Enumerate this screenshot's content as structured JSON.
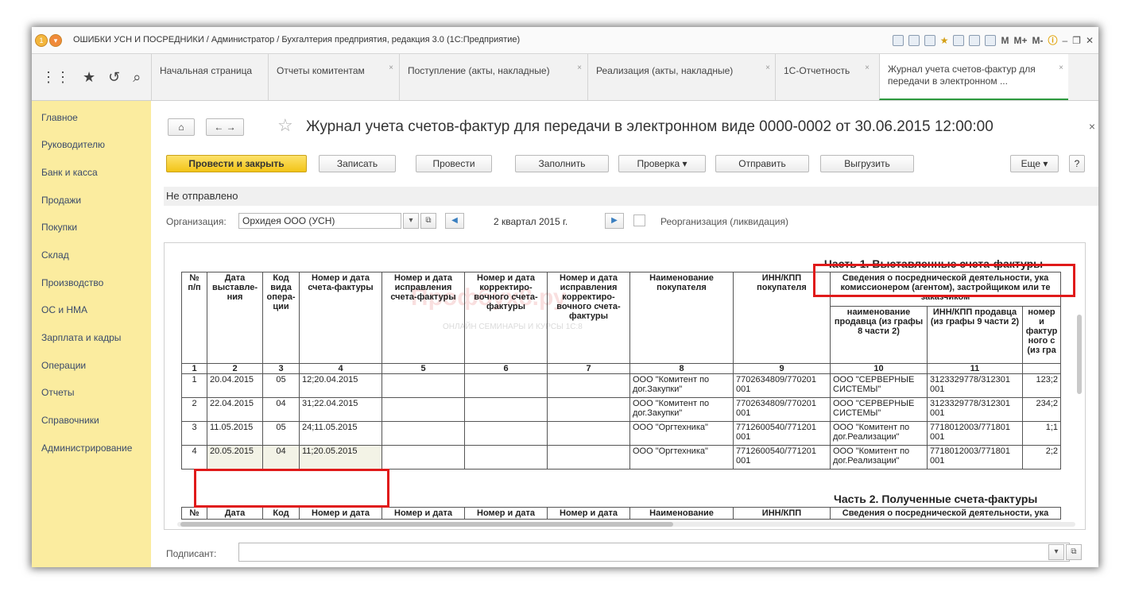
{
  "window": {
    "title": "ОШИБКИ УСН И ПОСРЕДНИКИ / Администратор / Бухгалтерия предприятия, редакция 3.0  (1С:Предприятие)",
    "tools": [
      "M",
      "M+",
      "M-"
    ]
  },
  "tabs": [
    {
      "label": "Начальная страница"
    },
    {
      "label": "Отчеты комитентам"
    },
    {
      "label": "Поступление (акты, накладные)"
    },
    {
      "label": "Реализация (акты, накладные)"
    },
    {
      "label": "1С-Отчетность"
    },
    {
      "label": "Журнал учета счетов-фактур для передачи в электронном ..."
    }
  ],
  "sidebar": {
    "items": [
      "Главное",
      "Руководителю",
      "Банк и касса",
      "Продажи",
      "Покупки",
      "Склад",
      "Производство",
      "ОС и НМА",
      "Зарплата и кадры",
      "Операции",
      "Отчеты",
      "Справочники",
      "Администрирование"
    ]
  },
  "document": {
    "title": "Журнал учета счетов-фактур для передачи в электронном виде 0000-0002 от 30.06.2015 12:00:00",
    "close": "×"
  },
  "toolbar": {
    "post_close": "Провести и закрыть",
    "save": "Записать",
    "post": "Провести",
    "fill": "Заполнить",
    "check": "Проверка",
    "send": "Отправить",
    "upload": "Выгрузить",
    "more": "Еще",
    "help": "?"
  },
  "status": "Не отправлено",
  "filters": {
    "org_label": "Организация:",
    "org_value": "Орхидея ООО (УСН)",
    "period": "2 квартал 2015 г.",
    "reorg": "Реорганизация (ликвидация)"
  },
  "report": {
    "part1": "Часть 1. Выставленные счета-фактуры",
    "part2": "Часть 2. Полученные счета-фактуры",
    "watermark": "Профбух8.ру",
    "watermark_sub": "ОНЛАЙН СЕМИНАРЫ И КУРСЫ 1С:8",
    "headers": [
      "№ п/п",
      "Дата выставле-ния",
      "Код вида опера-ции",
      "Номер и дата счета-фактуры",
      "Номер и дата исправления счета-фактуры",
      "Номер и дата корректиро-вочного счета-фактуры",
      "Номер и дата исправления корректиро-вочного счета-фактуры",
      "Наименование покупателя",
      "ИНН/КПП покупателя",
      "Сведения о посреднической деятельности, ука комиссионером (агентом), застройщиком или те заказчиком"
    ],
    "subheaders": [
      "наименование продавца (из графы 8 части 2)",
      "ИНН/КПП продавца (из графы 9 части 2)",
      "номер и фактур ного с (из гра"
    ],
    "numbers": [
      "1",
      "2",
      "3",
      "4",
      "5",
      "6",
      "7",
      "8",
      "9",
      "10",
      "11",
      ""
    ],
    "rows": [
      [
        "1",
        "20.04.2015",
        "05",
        "12;20.04.2015",
        "",
        "",
        "",
        "ООО \"Комитент по дог.Закупки\"",
        "7702634809/770201 001",
        "ООО \"СЕРВЕРНЫЕ СИСТЕМЫ\"",
        "3123329778/312301 001",
        "123;2"
      ],
      [
        "2",
        "22.04.2015",
        "04",
        "31;22.04.2015",
        "",
        "",
        "",
        "ООО \"Комитент по дог.Закупки\"",
        "7702634809/770201 001",
        "ООО \"СЕРВЕРНЫЕ СИСТЕМЫ\"",
        "3123329778/312301 001",
        "234;2"
      ],
      [
        "3",
        "11.05.2015",
        "05",
        "24;11.05.2015",
        "",
        "",
        "",
        "ООО \"Оргтехника\"",
        "7712600540/771201 001",
        "ООО \"Комитент по дог.Реализации\"",
        "7718012003/771801 001",
        "1;1"
      ],
      [
        "4",
        "20.05.2015",
        "04",
        "11;20.05.2015",
        "",
        "",
        "",
        "ООО \"Оргтехника\"",
        "7712600540/771201 001",
        "ООО \"Комитент по дог.Реализации\"",
        "7718012003/771801 001",
        "2;2"
      ]
    ],
    "headers2": [
      "№",
      "Дата",
      "Код",
      "Номер и дата",
      "Номер и дата",
      "Номер и дата",
      "Номер и дата",
      "Наименование",
      "ИНН/КПП",
      "Сведения о посреднической деятельности, ука"
    ]
  },
  "signer": {
    "label": "Подписант:"
  }
}
